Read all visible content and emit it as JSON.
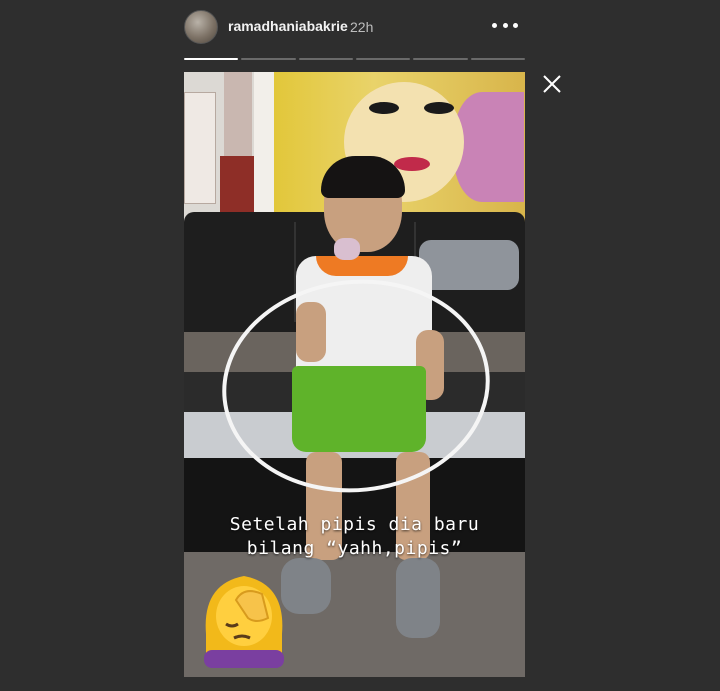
{
  "header": {
    "username": "ramadhaniabakrie",
    "time": "22h"
  },
  "progress": {
    "segments": 6,
    "active_index": 0
  },
  "story": {
    "caption_line1": "Setelah pipis dia baru",
    "caption_line2": "bilang “yahh,pipis”",
    "emoji": "face-palm-emoji",
    "circle_color": "#f5f5f5"
  },
  "icons": {
    "more": "more-horizontal-icon",
    "close": "close-icon"
  },
  "colors": {
    "background": "#2e2e2e",
    "progress_active": "#ffffff",
    "progress_inactive": "#6a6a6a"
  }
}
